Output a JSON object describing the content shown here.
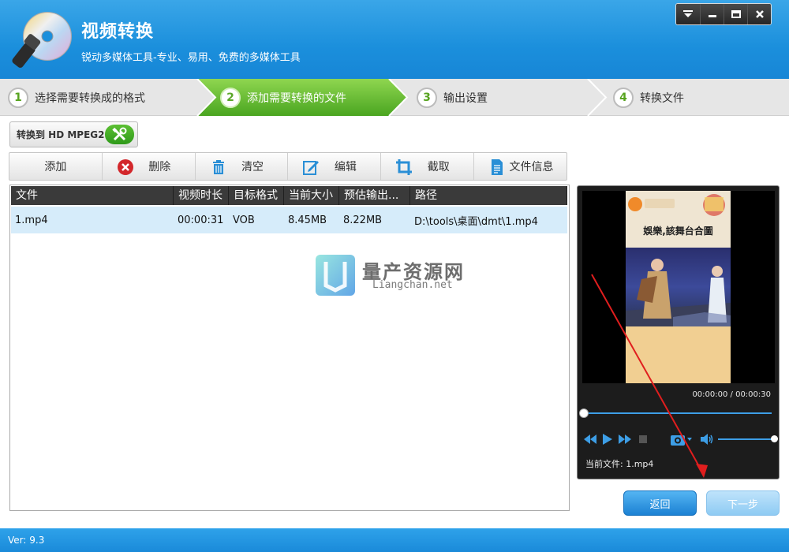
{
  "app": {
    "title": "视频转换",
    "subtitle": "锐动多媒体工具-专业、易用、免费的多媒体工具",
    "version": "Ver: 9.3"
  },
  "window_controls": [
    "menu-icon",
    "minimize-icon",
    "maximize-icon",
    "close-icon"
  ],
  "steps": [
    {
      "num": "1",
      "label": "选择需要转换成的格式",
      "active": false
    },
    {
      "num": "2",
      "label": "添加需要转换的文件",
      "active": true
    },
    {
      "num": "3",
      "label": "输出设置",
      "active": false
    },
    {
      "num": "4",
      "label": "转换文件",
      "active": false
    }
  ],
  "convert_target": {
    "label": "转换到 HD MPEG2"
  },
  "toolbar": {
    "add": "添加",
    "delete": "删除",
    "clear": "清空",
    "edit": "编辑",
    "crop": "截取",
    "info": "文件信息"
  },
  "table": {
    "columns": [
      "文件",
      "视频时长",
      "目标格式",
      "当前大小",
      "预估输出...",
      "路径"
    ],
    "rows": [
      {
        "file": "1.mp4",
        "duration": "00:00:31",
        "format": "VOB",
        "size": "8.45MB",
        "output": "8.22MB",
        "path": "D:\\tools\\桌面\\dmt\\1.mp4"
      }
    ]
  },
  "watermark": {
    "name": "量产资源网",
    "url": "Liangchan.net"
  },
  "preview": {
    "caption": "娛樂,該舞台合圖",
    "timecode": "00:00:00 / 00:00:30",
    "current_file_label": "当前文件: 1.mp4"
  },
  "buttons": {
    "back": "返回",
    "next": "下一步"
  },
  "colors": {
    "titlebar": "#1b8fdc",
    "active_step": "#5bb52c",
    "accent": "#3d9ee6",
    "annotation_arrow": "#e01e1e"
  }
}
